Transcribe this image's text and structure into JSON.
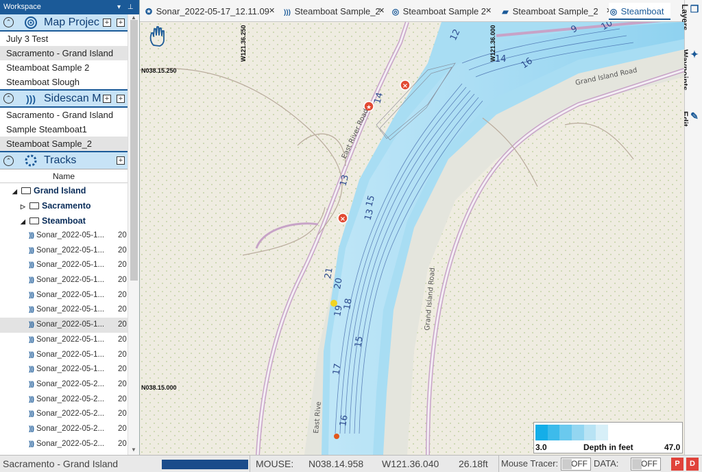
{
  "workspace": {
    "title": "Workspace"
  },
  "map_projects": {
    "title": "Map Projec",
    "items": [
      {
        "label": "July 3 Test",
        "selected": false
      },
      {
        "label": "Sacramento - Grand Island",
        "selected": true
      },
      {
        "label": "Steamboat Sample 2",
        "selected": false
      },
      {
        "label": "Steamboat Slough",
        "selected": false
      }
    ]
  },
  "sidescan": {
    "title": "Sidescan M",
    "items": [
      {
        "label": "Sacramento - Grand Island",
        "selected": false
      },
      {
        "label": "Sample Steamboat1",
        "selected": false
      },
      {
        "label": "Steamboat Sample_2",
        "selected": true
      }
    ]
  },
  "tracks": {
    "title": "Tracks",
    "column_header": "Name",
    "root": "Grand Island",
    "folders": [
      "Sacramento",
      "Steamboat"
    ],
    "leaves": [
      {
        "name": "Sonar_2022-05-1...",
        "value": "20",
        "selected": false
      },
      {
        "name": "Sonar_2022-05-1...",
        "value": "20",
        "selected": false
      },
      {
        "name": "Sonar_2022-05-1...",
        "value": "20",
        "selected": false
      },
      {
        "name": "Sonar_2022-05-1...",
        "value": "20",
        "selected": false
      },
      {
        "name": "Sonar_2022-05-1...",
        "value": "20",
        "selected": false
      },
      {
        "name": "Sonar_2022-05-1...",
        "value": "20",
        "selected": false
      },
      {
        "name": "Sonar_2022-05-1...",
        "value": "20",
        "selected": true
      },
      {
        "name": "Sonar_2022-05-1...",
        "value": "20",
        "selected": false
      },
      {
        "name": "Sonar_2022-05-1...",
        "value": "20",
        "selected": false
      },
      {
        "name": "Sonar_2022-05-1...",
        "value": "20",
        "selected": false
      },
      {
        "name": "Sonar_2022-05-2...",
        "value": "20",
        "selected": false
      },
      {
        "name": "Sonar_2022-05-2...",
        "value": "20",
        "selected": false
      },
      {
        "name": "Sonar_2022-05-2...",
        "value": "20",
        "selected": false
      },
      {
        "name": "Sonar_2022-05-2...",
        "value": "20",
        "selected": false
      },
      {
        "name": "Sonar_2022-05-2...",
        "value": "20",
        "selected": false
      }
    ]
  },
  "tabs": [
    {
      "label": "Sonar_2022-05-17_12.11.09",
      "icon": "track-icon",
      "active": false
    },
    {
      "label": "Steamboat Sample_2",
      "icon": "sidescan-icon",
      "active": false
    },
    {
      "label": "Steamboat Sample 2",
      "icon": "map-project-icon",
      "active": false
    },
    {
      "label": "Steamboat Sample_2",
      "icon": "image-layer-icon",
      "active": false
    },
    {
      "label": "Steamboat",
      "icon": "map-project-icon",
      "active": true
    }
  ],
  "right_tabs": [
    "Layers",
    "Waypoints",
    "Edit"
  ],
  "map": {
    "coords": {
      "lon_west": "W121.36.250",
      "lon_east": "W121.36.000",
      "lat_north": "N038.15.250",
      "lat_south": "N038.15.000"
    },
    "road_labels": [
      "Grand Island Road",
      "Grand Island Road",
      "East River Road",
      "East Rive"
    ],
    "depth_labels": [
      "10",
      "9",
      "12",
      "14",
      "16",
      "13",
      "13",
      "15",
      "14",
      "21",
      "20",
      "19",
      "18",
      "15",
      "17",
      "16"
    ],
    "legend": {
      "min": "3.0",
      "max": "47.0",
      "title": "Depth in feet",
      "colors": [
        "#14aee8",
        "#3dbbeb",
        "#6ac9ee",
        "#93d6f1",
        "#b8e3f4",
        "#d7eff8"
      ]
    }
  },
  "status": {
    "project": "Sacramento - Grand Island",
    "mouse_label": "MOUSE:",
    "mouse_lat": "N038.14.958",
    "mouse_lon": "W121.36.040",
    "depth": "26.18ft",
    "tracer_label": "Mouse Tracer:",
    "tracer_value": "OFF",
    "data_label": "DATA:",
    "data_value": "OFF",
    "btn_p": "P",
    "btn_d": "D"
  }
}
